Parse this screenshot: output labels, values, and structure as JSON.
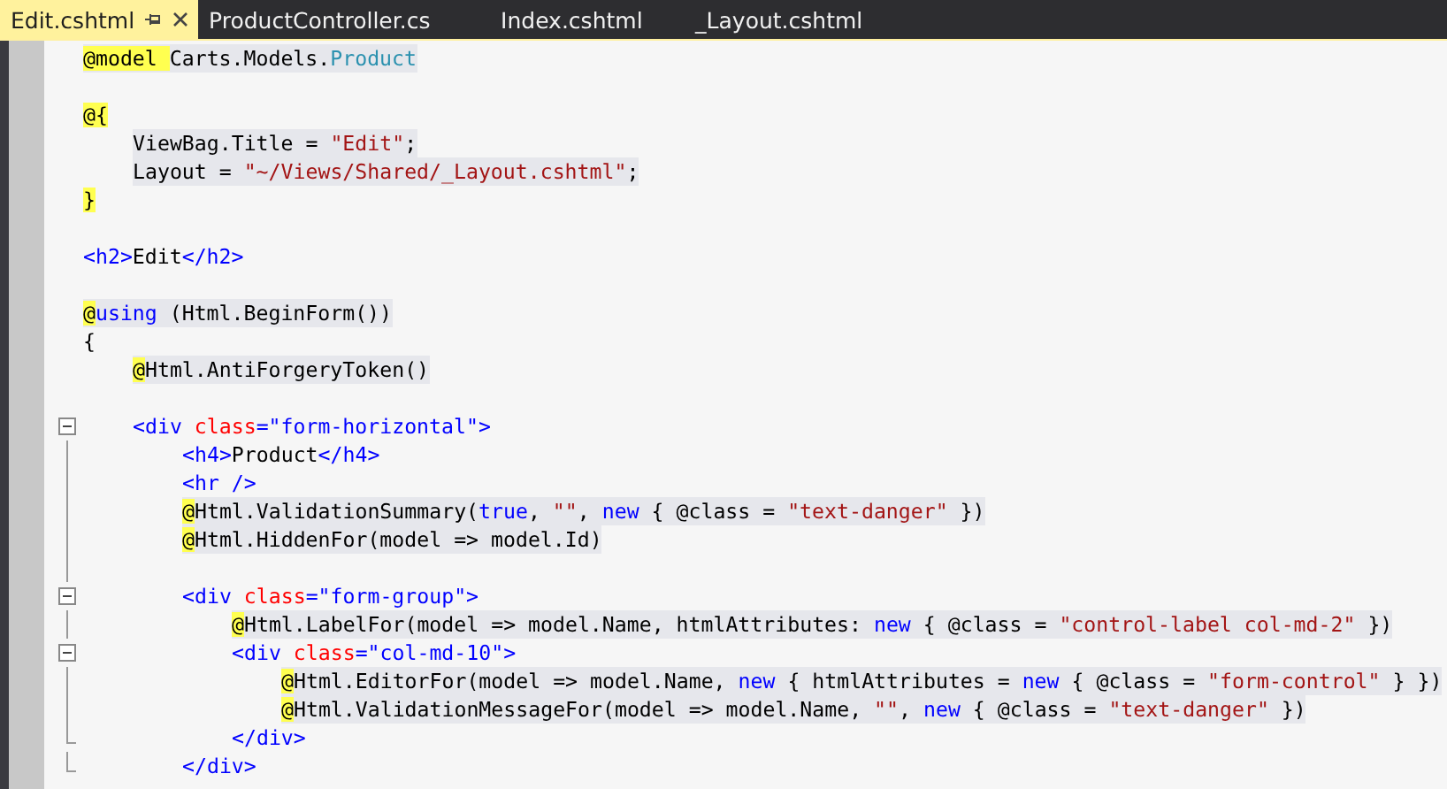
{
  "tabs": [
    {
      "label": "Edit.cshtml",
      "selected": true,
      "pinned": true
    },
    {
      "label": "ProductController.cs",
      "selected": false,
      "pinned": false
    },
    {
      "label": "Index.cshtml",
      "selected": false,
      "pinned": false
    },
    {
      "label": "_Layout.cshtml",
      "selected": false,
      "pinned": false
    }
  ],
  "lines": [
    {
      "kind": "plain",
      "shaded": true,
      "tokens": [
        {
          "kind": "at",
          "text": "@model "
        },
        {
          "kind": "plain",
          "text": "Carts.Models."
        },
        {
          "kind": "type",
          "text": "Product"
        }
      ]
    },
    {
      "kind": "plain",
      "blank_before": true,
      "tokens": [
        {
          "kind": "at",
          "text": "@{"
        }
      ]
    },
    {
      "kind": "plain",
      "shaded": true,
      "tokens": [
        {
          "kind": "plain",
          "text": "    ViewBag.Title = "
        },
        {
          "kind": "string",
          "text": "\"Edit\""
        },
        {
          "kind": "plain",
          "text": ";"
        }
      ]
    },
    {
      "kind": "plain",
      "shaded": true,
      "tokens": [
        {
          "kind": "plain",
          "text": "    Layout = "
        },
        {
          "kind": "string",
          "text": "\"~/Views/Shared/_Layout.cshtml\""
        },
        {
          "kind": "plain",
          "text": ";"
        }
      ]
    },
    {
      "kind": "plain",
      "tokens": [
        {
          "kind": "at",
          "text": "}"
        }
      ]
    },
    {
      "kind": "plain",
      "blank_before": true,
      "tokens": [
        {
          "kind": "tag",
          "text": "<h2>"
        },
        {
          "kind": "plain",
          "text": "Edit"
        },
        {
          "kind": "tag",
          "text": "</h2>"
        }
      ]
    },
    {
      "kind": "plain",
      "blank_before": true,
      "shaded": true,
      "tokens": [
        {
          "kind": "at",
          "text": "@"
        },
        {
          "kind": "keyword",
          "text": "using"
        },
        {
          "kind": "plain",
          "text": " (Html.BeginForm())"
        }
      ]
    },
    {
      "kind": "plain",
      "tokens": [
        {
          "kind": "plain",
          "text": "{"
        }
      ]
    },
    {
      "kind": "plain",
      "shaded": true,
      "tokens": [
        {
          "kind": "at",
          "text": "    @"
        },
        {
          "kind": "plain",
          "text": "Html.AntiForgeryToken()"
        }
      ]
    },
    {
      "kind": "fold_start",
      "blank_before": true,
      "tokens": [
        {
          "kind": "tag",
          "text": "    <div "
        },
        {
          "kind": "attr",
          "text": "class"
        },
        {
          "kind": "tag",
          "text": "=\"form-horizontal\">"
        }
      ]
    },
    {
      "kind": "fold_mid",
      "tokens": [
        {
          "kind": "tag",
          "text": "        <h4>"
        },
        {
          "kind": "plain",
          "text": "Product"
        },
        {
          "kind": "tag",
          "text": "</h4>"
        }
      ]
    },
    {
      "kind": "fold_mid",
      "tokens": [
        {
          "kind": "tag",
          "text": "        <hr />"
        }
      ]
    },
    {
      "kind": "fold_mid",
      "shaded": true,
      "tokens": [
        {
          "kind": "at",
          "text": "        @"
        },
        {
          "kind": "plain",
          "text": "Html.ValidationSummary("
        },
        {
          "kind": "keyword",
          "text": "true"
        },
        {
          "kind": "plain",
          "text": ", "
        },
        {
          "kind": "string",
          "text": "\"\""
        },
        {
          "kind": "plain",
          "text": ", "
        },
        {
          "kind": "keyword",
          "text": "new"
        },
        {
          "kind": "plain",
          "text": " { @class = "
        },
        {
          "kind": "string",
          "text": "\"text-danger\""
        },
        {
          "kind": "plain",
          "text": " })"
        }
      ]
    },
    {
      "kind": "fold_mid",
      "shaded": true,
      "tokens": [
        {
          "kind": "at",
          "text": "        @"
        },
        {
          "kind": "plain",
          "text": "Html.HiddenFor(model => model.Id)"
        }
      ]
    },
    {
      "kind": "fold_start",
      "blank_before": true,
      "tokens": [
        {
          "kind": "tag",
          "text": "        <div "
        },
        {
          "kind": "attr",
          "text": "class"
        },
        {
          "kind": "tag",
          "text": "=\"form-group\">"
        }
      ]
    },
    {
      "kind": "fold_mid",
      "shaded": true,
      "tokens": [
        {
          "kind": "at",
          "text": "            @"
        },
        {
          "kind": "plain",
          "text": "Html.LabelFor(model => model.Name, htmlAttributes: "
        },
        {
          "kind": "keyword",
          "text": "new"
        },
        {
          "kind": "plain",
          "text": " { @class = "
        },
        {
          "kind": "string",
          "text": "\"control-label col-md-2\""
        },
        {
          "kind": "plain",
          "text": " })"
        }
      ]
    },
    {
      "kind": "fold_start",
      "tokens": [
        {
          "kind": "tag",
          "text": "            <div "
        },
        {
          "kind": "attr",
          "text": "class"
        },
        {
          "kind": "tag",
          "text": "=\"col-md-10\">"
        }
      ]
    },
    {
      "kind": "fold_mid",
      "shaded": true,
      "tokens": [
        {
          "kind": "at",
          "text": "                @"
        },
        {
          "kind": "plain",
          "text": "Html.EditorFor(model => model.Name, "
        },
        {
          "kind": "keyword",
          "text": "new"
        },
        {
          "kind": "plain",
          "text": " { htmlAttributes = "
        },
        {
          "kind": "keyword",
          "text": "new"
        },
        {
          "kind": "plain",
          "text": " { @class = "
        },
        {
          "kind": "string",
          "text": "\"form-control\""
        },
        {
          "kind": "plain",
          "text": " } })"
        }
      ]
    },
    {
      "kind": "fold_mid",
      "shaded": true,
      "tokens": [
        {
          "kind": "at",
          "text": "                @"
        },
        {
          "kind": "plain",
          "text": "Html.ValidationMessageFor(model => model.Name, "
        },
        {
          "kind": "string",
          "text": "\"\""
        },
        {
          "kind": "plain",
          "text": ", "
        },
        {
          "kind": "keyword",
          "text": "new"
        },
        {
          "kind": "plain",
          "text": " { @class = "
        },
        {
          "kind": "string",
          "text": "\"text-danger\""
        },
        {
          "kind": "plain",
          "text": " })"
        }
      ]
    },
    {
      "kind": "fold_end",
      "tokens": [
        {
          "kind": "tag",
          "text": "            </div>"
        }
      ]
    },
    {
      "kind": "fold_end",
      "tokens": [
        {
          "kind": "tag",
          "text": "        </div>"
        }
      ]
    }
  ]
}
